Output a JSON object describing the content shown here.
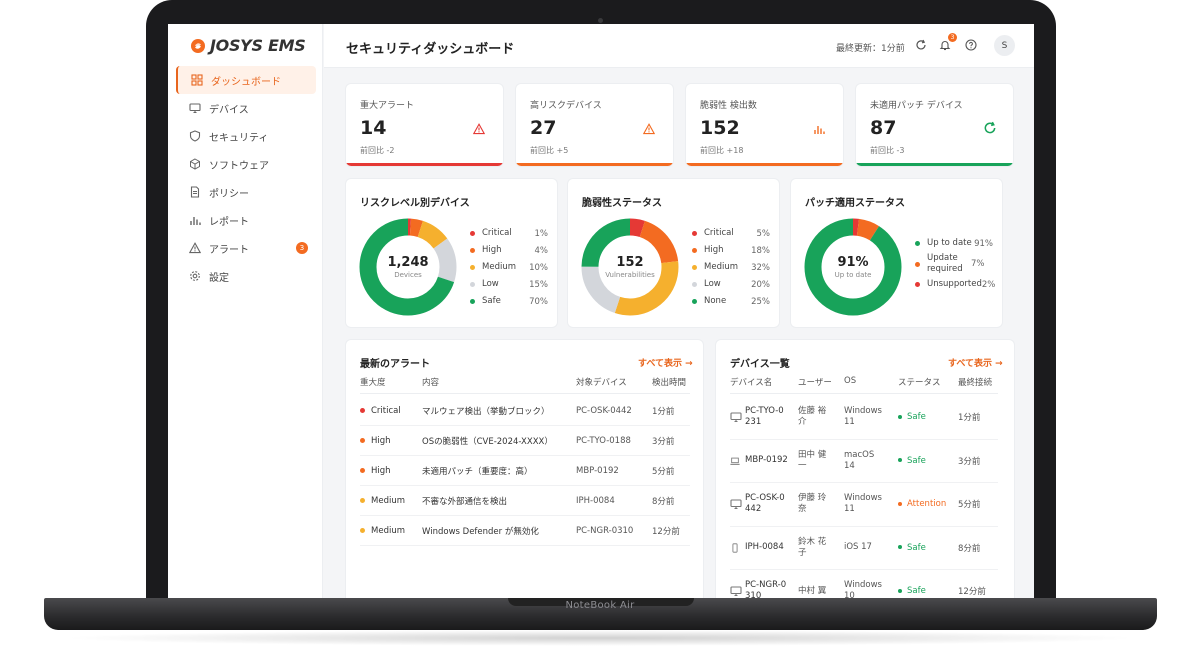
{
  "device_label": "NoteBook Air",
  "colors": {
    "accent": "#e8651d",
    "critical": "#e53935",
    "high": "#f36b21",
    "medium": "#f5b02e",
    "low": "#d3d6db",
    "safe": "#18a35a"
  },
  "sidebar": {
    "logo": "JOSYS EMS",
    "items": [
      {
        "label": "ダッシュボード",
        "icon": "grid-icon",
        "active": true
      },
      {
        "label": "デバイス",
        "icon": "monitor-icon"
      },
      {
        "label": "セキュリティ",
        "icon": "shield-icon"
      },
      {
        "label": "ソフトウェア",
        "icon": "cube-icon"
      },
      {
        "label": "ポリシー",
        "icon": "document-icon"
      },
      {
        "label": "レポート",
        "icon": "bar-chart-icon"
      },
      {
        "label": "アラート",
        "icon": "warning-icon",
        "badge": "3"
      },
      {
        "label": "設定",
        "icon": "gear-icon"
      }
    ]
  },
  "header": {
    "title": "セキュリティダッシュボード",
    "updated": "最終更新：1分前",
    "bell_badge": "3",
    "avatar": "S"
  },
  "kpis": [
    {
      "label": "重大アラート",
      "value": "14",
      "delta": "前回比 -2",
      "icon": "warning-icon",
      "color": "#e53935"
    },
    {
      "label": "高リスクデバイス",
      "value": "27",
      "delta": "前回比 +5",
      "icon": "warning-icon",
      "color": "#f36b21"
    },
    {
      "label": "脆弱性 検出数",
      "value": "152",
      "delta": "前回比 +18",
      "icon": "bar-chart-icon",
      "color": "#f36b21"
    },
    {
      "label": "未適用パッチ デバイス",
      "value": "87",
      "delta": "前回比 -3",
      "icon": "refresh-icon",
      "color": "#18a35a"
    }
  ],
  "donuts": [
    {
      "title": "リスクレベル別デバイス",
      "center_value": "1,248",
      "center_unit": "Devices",
      "segments": [
        {
          "name": "Critical",
          "label": "1%",
          "pct": 1,
          "color": "#e53935"
        },
        {
          "name": "High",
          "label": "4%",
          "pct": 4,
          "color": "#f36b21"
        },
        {
          "name": "Medium",
          "label": "10%",
          "pct": 10,
          "color": "#f5b02e"
        },
        {
          "name": "Low",
          "label": "15%",
          "pct": 15,
          "color": "#d3d6db"
        },
        {
          "name": "Safe",
          "label": "70%",
          "pct": 70,
          "color": "#18a35a"
        }
      ]
    },
    {
      "title": "脆弱性ステータス",
      "center_value": "152",
      "center_unit": "Vulnerabilities",
      "segments": [
        {
          "name": "Critical",
          "label": "5%",
          "pct": 5,
          "color": "#e53935"
        },
        {
          "name": "High",
          "label": "18%",
          "pct": 18,
          "color": "#f36b21"
        },
        {
          "name": "Medium",
          "label": "32%",
          "pct": 32,
          "color": "#f5b02e"
        },
        {
          "name": "Low",
          "label": "20%",
          "pct": 20,
          "color": "#d3d6db"
        },
        {
          "name": "None",
          "label": "25%",
          "pct": 25,
          "color": "#18a35a"
        }
      ]
    },
    {
      "title": "パッチ適用ステータス",
      "center_value": "91%",
      "center_unit": "Up to date",
      "segments": [
        {
          "name": "Unsupported",
          "label": "2%",
          "pct": 2,
          "color": "#e53935"
        },
        {
          "name": "Update required",
          "label": "7%",
          "pct": 7,
          "color": "#f36b21"
        },
        {
          "name": "Up to date",
          "label": "91%",
          "pct": 91,
          "color": "#18a35a"
        }
      ],
      "legend_order": [
        2,
        1,
        0
      ]
    }
  ],
  "alerts": {
    "title": "最新のアラート",
    "see_all": "すべて表示 →",
    "columns": [
      "重大度",
      "内容",
      "対象デバイス",
      "検出時間"
    ],
    "rows": [
      {
        "severity": "Critical",
        "color": "#e53935",
        "content": "マルウェア検出（挙動ブロック）",
        "device": "PC-OSK-0442",
        "time": "1分前"
      },
      {
        "severity": "High",
        "color": "#f36b21",
        "content": "OSの脆弱性（CVE-2024-XXXX）",
        "device": "PC-TYO-0188",
        "time": "3分前"
      },
      {
        "severity": "High",
        "color": "#f36b21",
        "content": "未適用パッチ（重要度：高）",
        "device": "MBP-0192",
        "time": "5分前"
      },
      {
        "severity": "Medium",
        "color": "#f5b02e",
        "content": "不審な外部通信を検出",
        "device": "IPH-0084",
        "time": "8分前"
      },
      {
        "severity": "Medium",
        "color": "#f5b02e",
        "content": "Windows Defender が無効化",
        "device": "PC-NGR-0310",
        "time": "12分前"
      }
    ]
  },
  "devices": {
    "title": "デバイス一覧",
    "see_all": "すべて表示 →",
    "columns": [
      "デバイス名",
      "ユーザー",
      "OS",
      "ステータス",
      "最終接続"
    ],
    "rows": [
      {
        "icon": "monitor-icon",
        "name": "PC-TYO-0231",
        "user": "佐藤 裕介",
        "os": "Windows 11",
        "status": "Safe",
        "status_color": "#18a35a",
        "last": "1分前"
      },
      {
        "icon": "laptop-icon",
        "name": "MBP-0192",
        "user": "田中 健一",
        "os": "macOS 14",
        "status": "Safe",
        "status_color": "#18a35a",
        "last": "3分前"
      },
      {
        "icon": "monitor-icon",
        "name": "PC-OSK-0442",
        "user": "伊藤 玲奈",
        "os": "Windows 11",
        "status": "Attention",
        "status_color": "#f36b21",
        "last": "5分前"
      },
      {
        "icon": "phone-icon",
        "name": "IPH-0084",
        "user": "鈴木 花子",
        "os": "iOS 17",
        "status": "Safe",
        "status_color": "#18a35a",
        "last": "8分前"
      },
      {
        "icon": "monitor-icon",
        "name": "PC-NGR-0310",
        "user": "中村 翼",
        "os": "Windows 10",
        "status": "Safe",
        "status_color": "#18a35a",
        "last": "12分前"
      }
    ]
  }
}
